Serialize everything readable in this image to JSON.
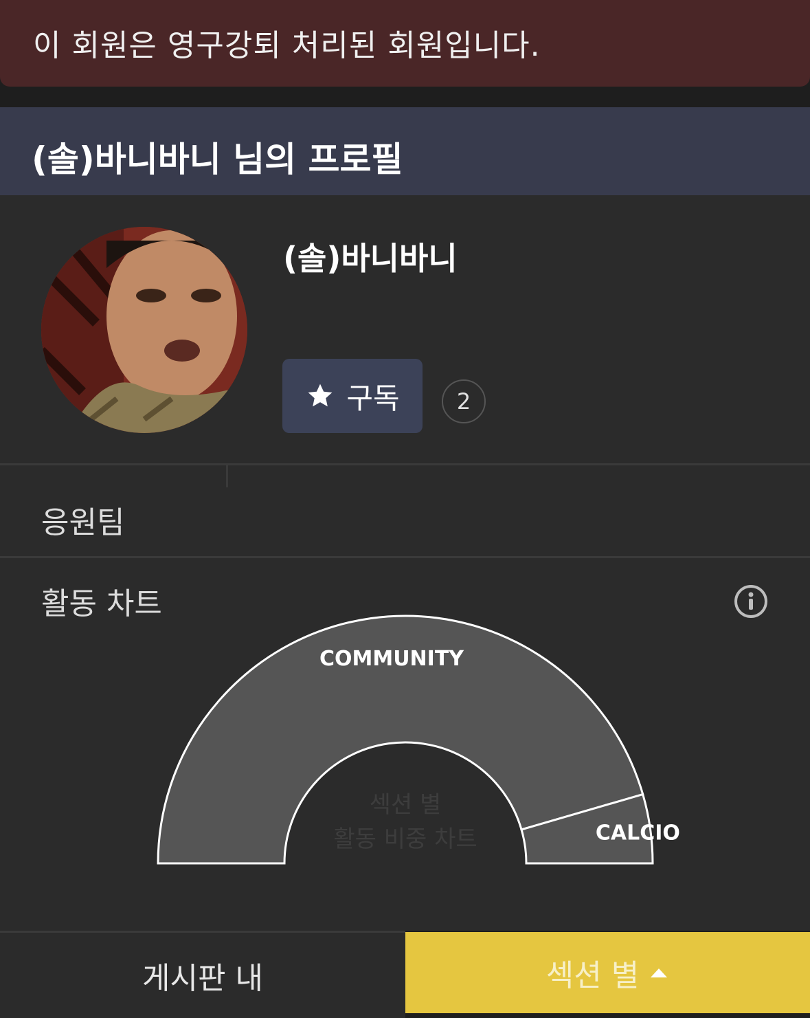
{
  "alert": {
    "message": "이 회원은 영구강퇴 처리된 회원입니다."
  },
  "header": {
    "title": "(솔)바니바니 님의 프로필"
  },
  "profile": {
    "username": "(솔)바니바니",
    "subscribe_label": "구독",
    "subscriber_count": "2",
    "team_label": "응원팀"
  },
  "activity": {
    "title": "활동 차트",
    "center_line1": "섹션 별",
    "center_line2": "활동 비중 차트"
  },
  "chart_data": {
    "type": "pie",
    "categories": [
      "COMMUNITY",
      "CALCIO"
    ],
    "values": [
      91,
      9
    ]
  },
  "bottom_tabs": {
    "board_label": "게시판 내",
    "section_label": "섹션 별"
  },
  "colors": {
    "alert_bg": "#4a2627",
    "header_bg": "#383b4d",
    "accent_yellow": "#e5c640",
    "chart_fill": "#555555"
  },
  "icons": {
    "subscribe": "star-icon",
    "info": "info-icon",
    "tab_caret": "caret-up-icon"
  }
}
